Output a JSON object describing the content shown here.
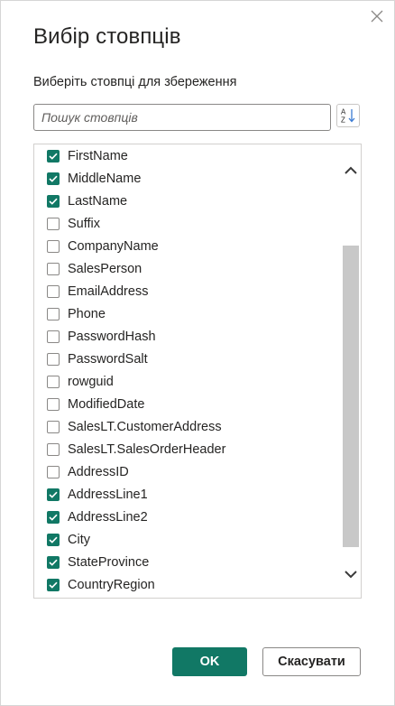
{
  "dialog": {
    "title": "Вибір стовпців",
    "subtitle": "Виберіть стовпці для збереження",
    "close_icon": "close-icon"
  },
  "search": {
    "placeholder": "Пошук стовпців",
    "value": ""
  },
  "sort_button": {
    "icon": "sort-az-icon"
  },
  "columns": [
    {
      "label": "FirstName",
      "checked": true
    },
    {
      "label": "MiddleName",
      "checked": true
    },
    {
      "label": "LastName",
      "checked": true
    },
    {
      "label": "Suffix",
      "checked": false
    },
    {
      "label": "CompanyName",
      "checked": false
    },
    {
      "label": "SalesPerson",
      "checked": false
    },
    {
      "label": "EmailAddress",
      "checked": false
    },
    {
      "label": "Phone",
      "checked": false
    },
    {
      "label": "PasswordHash",
      "checked": false
    },
    {
      "label": "PasswordSalt",
      "checked": false
    },
    {
      "label": "rowguid",
      "checked": false
    },
    {
      "label": "ModifiedDate",
      "checked": false
    },
    {
      "label": "SalesLT.CustomerAddress",
      "checked": false
    },
    {
      "label": "SalesLT.SalesOrderHeader",
      "checked": false
    },
    {
      "label": "AddressID",
      "checked": false
    },
    {
      "label": "AddressLine1",
      "checked": true
    },
    {
      "label": "AddressLine2",
      "checked": true
    },
    {
      "label": "City",
      "checked": true
    },
    {
      "label": "StateProvince",
      "checked": true
    },
    {
      "label": "CountryRegion",
      "checked": true
    }
  ],
  "buttons": {
    "ok_label": "OK",
    "cancel_label": "Скасувати"
  },
  "colors": {
    "accent": "#117865",
    "text": "#252423",
    "border": "#8a8886",
    "scroll_thumb": "#c8c8c8"
  }
}
